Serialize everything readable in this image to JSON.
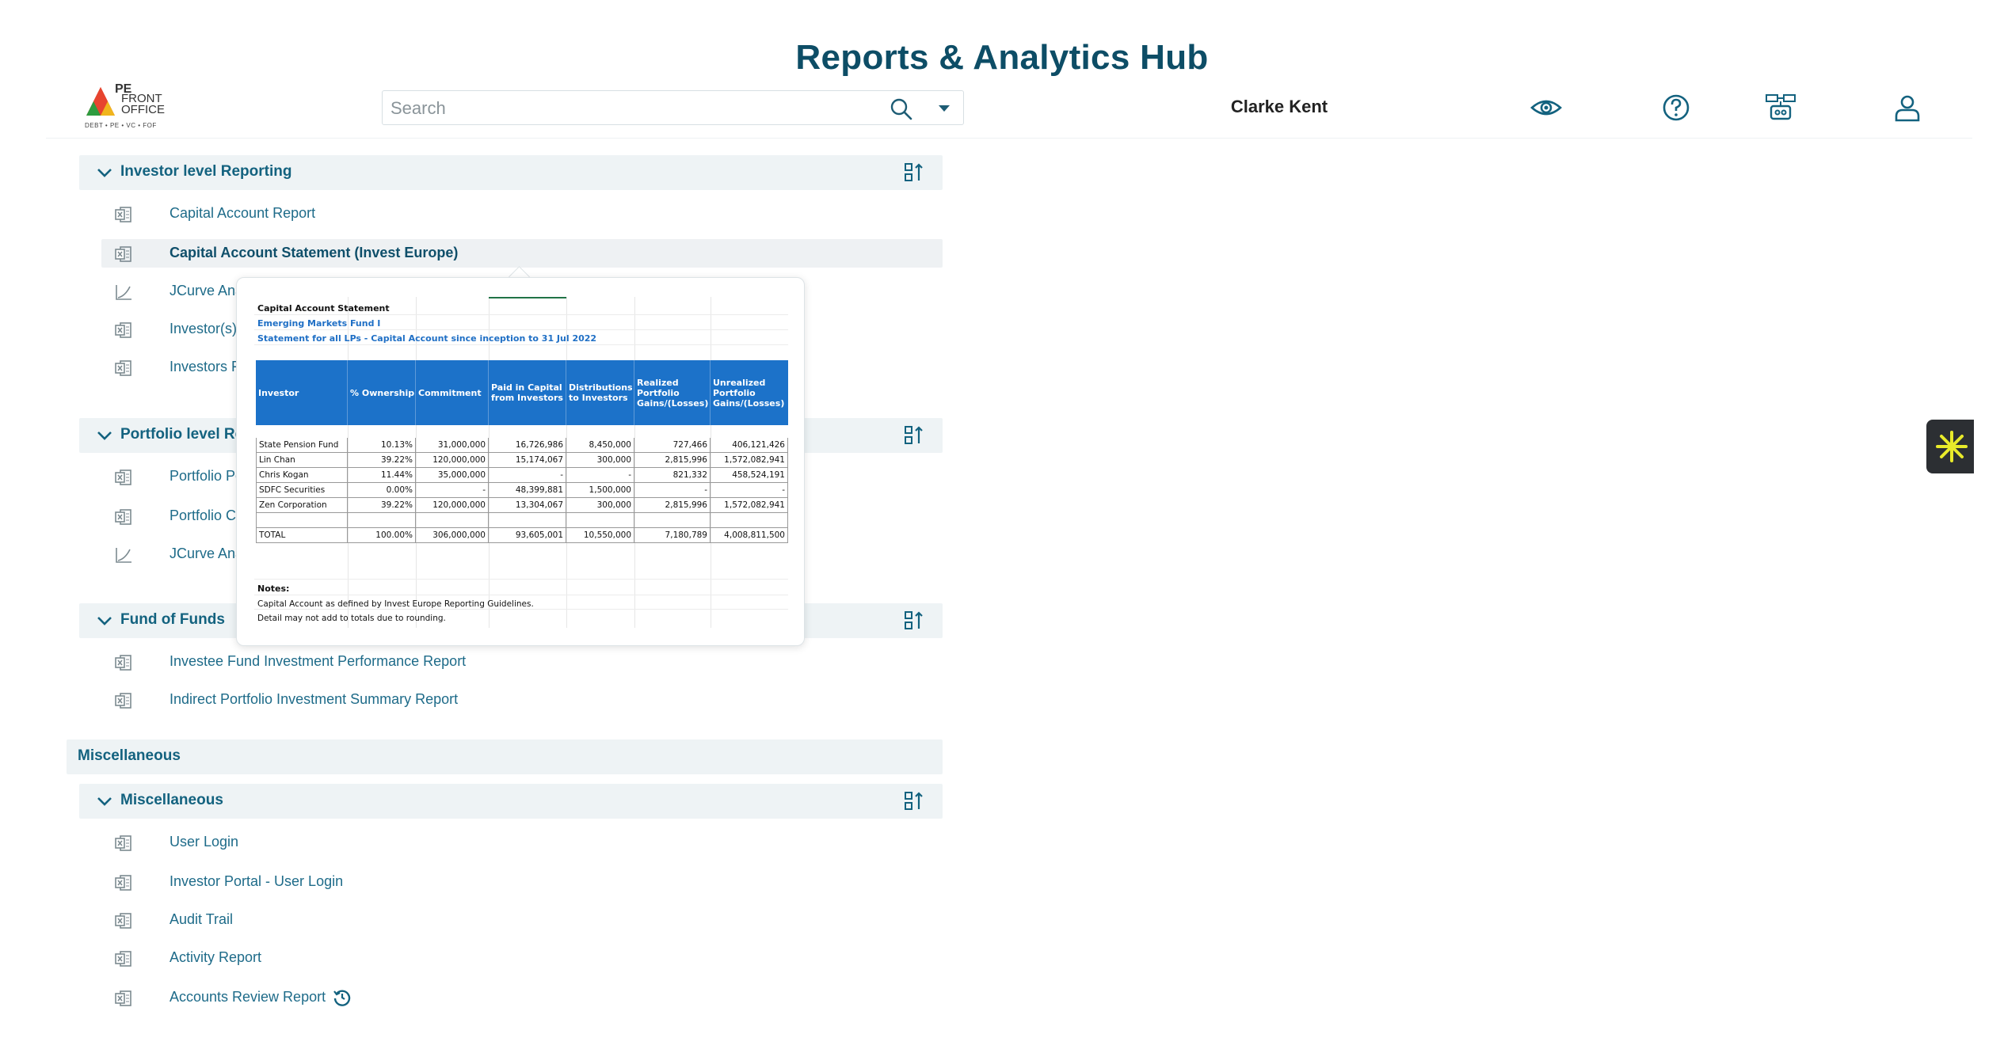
{
  "header": {
    "title": "Reports & Analytics Hub",
    "logo": {
      "line1": "PE",
      "line2": "FRONT",
      "line3": "OFFICE",
      "tagline": "DEBT • PE • VC • FOF"
    },
    "search_placeholder": "Search",
    "user_name": "Clarke Kent",
    "icons": [
      "eye-icon",
      "help-icon",
      "integration-icon",
      "user-icon"
    ]
  },
  "sections": {
    "investor": {
      "label": "Investor level Reporting",
      "items": [
        {
          "label": "Capital Account Report",
          "icon": "excel-icon"
        },
        {
          "label": "Capital Account Statement (Invest Europe)",
          "icon": "excel-icon",
          "active": true
        },
        {
          "label": "JCurve Ana",
          "icon": "chart-icon"
        },
        {
          "label": "Investor(s)",
          "icon": "excel-icon"
        },
        {
          "label": "Investors F",
          "icon": "excel-icon"
        }
      ]
    },
    "portfolio": {
      "label": "Portfolio level Rep",
      "items": [
        {
          "label": "Portfolio Pe",
          "icon": "excel-icon"
        },
        {
          "label": "Portfolio Co",
          "icon": "excel-icon"
        },
        {
          "label": "JCurve Ana",
          "icon": "chart-icon"
        }
      ]
    },
    "fof": {
      "label": "Fund of Funds",
      "items": [
        {
          "label": "Investee Fund Investment Performance Report",
          "icon": "excel-icon"
        },
        {
          "label": "Indirect Portfolio Investment Summary Report",
          "icon": "excel-icon"
        }
      ]
    },
    "misc_group": {
      "label": "Miscellaneous"
    },
    "misc": {
      "label": "Miscellaneous",
      "items": [
        {
          "label": "User Login",
          "icon": "excel-icon"
        },
        {
          "label": "Investor Portal - User Login",
          "icon": "excel-icon"
        },
        {
          "label": "Audit Trail",
          "icon": "excel-icon"
        },
        {
          "label": "Activity Report",
          "icon": "excel-icon"
        },
        {
          "label": "Accounts Review Report",
          "icon": "excel-icon",
          "extra_icon": "history-icon"
        }
      ]
    }
  },
  "preview": {
    "title": "Capital Account Statement",
    "fund": "Emerging Markets Fund I",
    "subtitle": "Statement for all LPs - Capital Account since inception to 31 Jul 2022",
    "columns": [
      "Investor",
      "% Ownership",
      "Commitment",
      "Paid in Capital from Investors",
      "Distributions to Investors",
      "Realized Portfolio Gains/(Losses)",
      "Unrealized Portfolio Gains/(Losses)"
    ],
    "rows": [
      [
        "State Pension Fund",
        "10.13%",
        "31,000,000",
        "16,726,986",
        "8,450,000",
        "727,466",
        "406,121,426"
      ],
      [
        "Lin Chan",
        "39.22%",
        "120,000,000",
        "15,174,067",
        "300,000",
        "2,815,996",
        "1,572,082,941"
      ],
      [
        "Chris Kogan",
        "11.44%",
        "35,000,000",
        "-",
        "-",
        "821,332",
        "458,524,191"
      ],
      [
        "SDFC Securities",
        "0.00%",
        "-",
        "48,399,881",
        "1,500,000",
        "-",
        "-"
      ],
      [
        "Zen Corporation",
        "39.22%",
        "120,000,000",
        "13,304,067",
        "300,000",
        "2,815,996",
        "1,572,082,941"
      ]
    ],
    "total": [
      "TOTAL",
      "100.00%",
      "306,000,000",
      "93,605,001",
      "10,550,000",
      "7,180,789",
      "4,008,811,500"
    ],
    "notes_label": "Notes:",
    "note1": "Capital Account as defined by Invest Europe Reporting Guidelines.",
    "note2": "Detail may not add to totals due to rounding."
  },
  "colors": {
    "accent": "#13627f",
    "title": "#0d4d66",
    "section_bg": "#eef3f5",
    "sheet_header": "#1c72c9",
    "widget": "#2c2f33",
    "widget_star": "#e8ea2a"
  }
}
